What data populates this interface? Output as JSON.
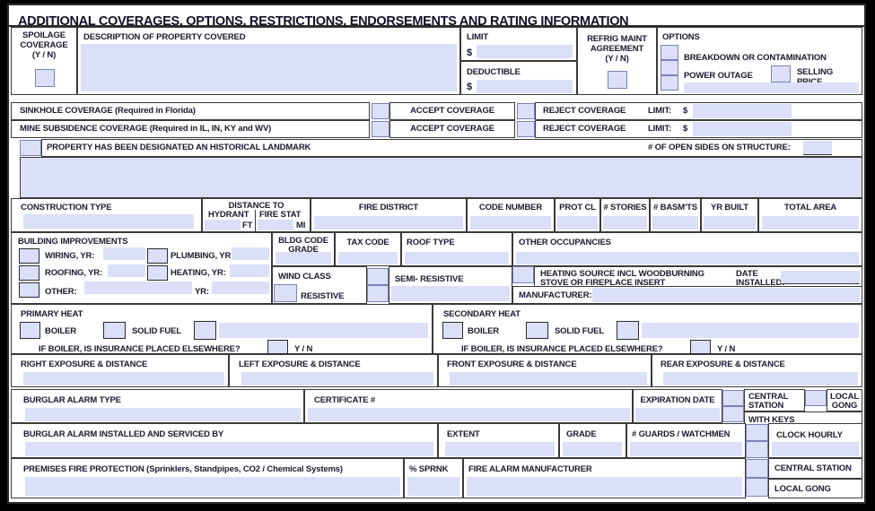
{
  "form": {
    "title": "ADDITIONAL COVERAGES, OPTIONS, RESTRICTIONS, ENDORSEMENTS AND RATING INFORMATION",
    "accent_field_color": "#dbe0f8",
    "border_color": "#2b2b2b"
  },
  "spoilage": {
    "line1": "SPOILAGE",
    "line2": "COVERAGE",
    "line3": "(Y / N)",
    "value": ""
  },
  "description": {
    "label": "DESCRIPTION OF PROPERTY COVERED",
    "value": ""
  },
  "limit": {
    "label": "LIMIT",
    "currency": "$",
    "value": ""
  },
  "deductible": {
    "label": "DEDUCTIBLE",
    "currency": "$",
    "value": ""
  },
  "refrig": {
    "line1": "REFRIG MAINT",
    "line2": "AGREEMENT",
    "line3": "(Y / N)",
    "value": ""
  },
  "options": {
    "label": "OPTIONS",
    "breakdown": "BREAKDOWN OR CONTAMINATION",
    "power_outage": "POWER OUTAGE",
    "selling_price_1": "SELLING",
    "selling_price_2": "PRICE",
    "breakdown_checked": "",
    "power_outage_checked": "",
    "selling_price_checked": "",
    "extra_checked": ""
  },
  "sinkhole": {
    "label": "SINKHOLE COVERAGE (Required in Florida)",
    "accept": "ACCEPT COVERAGE",
    "reject": "REJECT COVERAGE",
    "limit_label": "LIMIT:",
    "currency": "$",
    "limit_value": ""
  },
  "mine": {
    "label": "MINE SUBSIDENCE COVERAGE (Required in IL, IN, KY and WV)",
    "accept": "ACCEPT COVERAGE",
    "reject": "REJECT COVERAGE",
    "limit_label": "LIMIT:",
    "currency": "$",
    "limit_value": ""
  },
  "landmark": {
    "label": "PROPERTY HAS BEEN DESIGNATED AN HISTORICAL LANDMARK",
    "checked": "",
    "open_sides_label": "# OF OPEN SIDES ON STRUCTURE:",
    "open_sides_value": ""
  },
  "remarks": {
    "value": ""
  },
  "construction": {
    "label": "CONSTRUCTION TYPE",
    "value": ""
  },
  "distance": {
    "heading": "DISTANCE TO",
    "hydrant_label": "HYDRANT",
    "firestat_label": "FIRE STAT",
    "hydrant_unit": "FT",
    "firestat_unit": "MI",
    "hydrant_value": "",
    "firestat_value": ""
  },
  "fire_district": {
    "label": "FIRE DISTRICT",
    "value": ""
  },
  "code_number": {
    "label": "CODE NUMBER",
    "value": ""
  },
  "prot_cl": {
    "label": "PROT CL",
    "value": ""
  },
  "stories": {
    "label": "# STORIES",
    "value": ""
  },
  "basements": {
    "label": "# BASM'TS",
    "value": ""
  },
  "yr_built": {
    "label": "YR BUILT",
    "value": ""
  },
  "total_area": {
    "label": "TOTAL AREA",
    "value": ""
  },
  "building_improvements": {
    "heading": "BUILDING IMPROVEMENTS",
    "wiring_label": "WIRING, YR:",
    "wiring_value": "",
    "plumbing_label": "PLUMBING, YR:",
    "plumbing_value": "",
    "roofing_label": "ROOFING, YR:",
    "roofing_value": "",
    "heating_label": "HEATING, YR:",
    "heating_value": "",
    "other_label": "OTHER:",
    "other_value": "",
    "other_yr_label": "YR:",
    "other_yr_value": ""
  },
  "bldg_code_grade": {
    "line1": "BLDG CODE",
    "line2": "GRADE",
    "value": ""
  },
  "tax_code": {
    "label": "TAX CODE",
    "value": ""
  },
  "roof_type": {
    "label": "ROOF TYPE",
    "value": ""
  },
  "other_occupancies": {
    "label": "OTHER OCCUPANCIES",
    "value": ""
  },
  "wind_class": {
    "label": "WIND CLASS",
    "resistive": "RESISTIVE",
    "semi_resistive": "SEMI- RESISTIVE",
    "resistive_checked": "",
    "semi_resistive_checked": "",
    "semi_resistive_value": ""
  },
  "heating_source": {
    "line1": "HEATING SOURCE INCL WOODBURNING",
    "line2": "STOVE OR FIREPLACE INSERT",
    "checked": "",
    "date_label_1": "DATE",
    "date_label_2": "INSTALLED:",
    "date_value": "",
    "manufacturer_label": "MANUFACTURER:",
    "manufacturer_value": ""
  },
  "primary_heat": {
    "heading": "PRIMARY HEAT",
    "boiler_label": "BOILER",
    "boiler_checked": "",
    "solid_fuel_label": "SOLID FUEL",
    "solid_fuel_checked": "",
    "other_checked": "",
    "other_value": "",
    "elsewhere_label": "IF BOILER, IS INSURANCE PLACED ELSEWHERE?",
    "elsewhere_checked": "",
    "yn_label": "Y / N"
  },
  "secondary_heat": {
    "heading": "SECONDARY HEAT",
    "boiler_label": "BOILER",
    "boiler_checked": "",
    "solid_fuel_label": "SOLID FUEL",
    "solid_fuel_checked": "",
    "other_checked": "",
    "other_value": "",
    "elsewhere_label": "IF BOILER, IS INSURANCE PLACED ELSEWHERE?",
    "elsewhere_checked": "",
    "yn_label": "Y / N"
  },
  "exposures": [
    {
      "label": "RIGHT EXPOSURE & DISTANCE",
      "value": ""
    },
    {
      "label": "LEFT EXPOSURE & DISTANCE",
      "value": ""
    },
    {
      "label": "FRONT EXPOSURE & DISTANCE",
      "value": ""
    },
    {
      "label": "REAR EXPOSURE & DISTANCE",
      "value": ""
    }
  ],
  "burglar_alarm": {
    "type_label": "BURGLAR ALARM TYPE",
    "type_value": "",
    "certificate_label": "CERTIFICATE #",
    "certificate_value": "",
    "expiration_label": "EXPIRATION DATE",
    "expiration_value": "",
    "central_station_1": "CENTRAL",
    "central_station_2": "STATION",
    "central_station_checked": "",
    "local_gong_1": "LOCAL",
    "local_gong_2": "GONG",
    "local_gong_checked": "",
    "with_keys_label": "WITH KEYS",
    "installed_label": "BURGLAR ALARM INSTALLED AND SERVICED BY",
    "installed_value": ""
  },
  "alarm_details": {
    "extent_label": "EXTENT",
    "extent_value": "",
    "grade_label": "GRADE",
    "grade_value": "",
    "guards_label": "# GUARDS / WATCHMEN",
    "guards_value": "",
    "clock_hourly_label": "CLOCK HOURLY",
    "clock_hourly_checked": "",
    "clock_hourly_value": ""
  },
  "fire_protection": {
    "premises_label": "PREMISES FIRE PROTECTION (Sprinklers, Standpipes, CO2 / Chemical Systems)",
    "premises_value": "",
    "sprnk_label": "% SPRNK",
    "sprnk_value": "",
    "manufacturer_label": "FIRE ALARM MANUFACTURER",
    "manufacturer_value": "",
    "central_station_label": "CENTRAL STATION",
    "central_station_checked": "",
    "local_gong_label": "LOCAL GONG",
    "local_gong_checked": ""
  }
}
